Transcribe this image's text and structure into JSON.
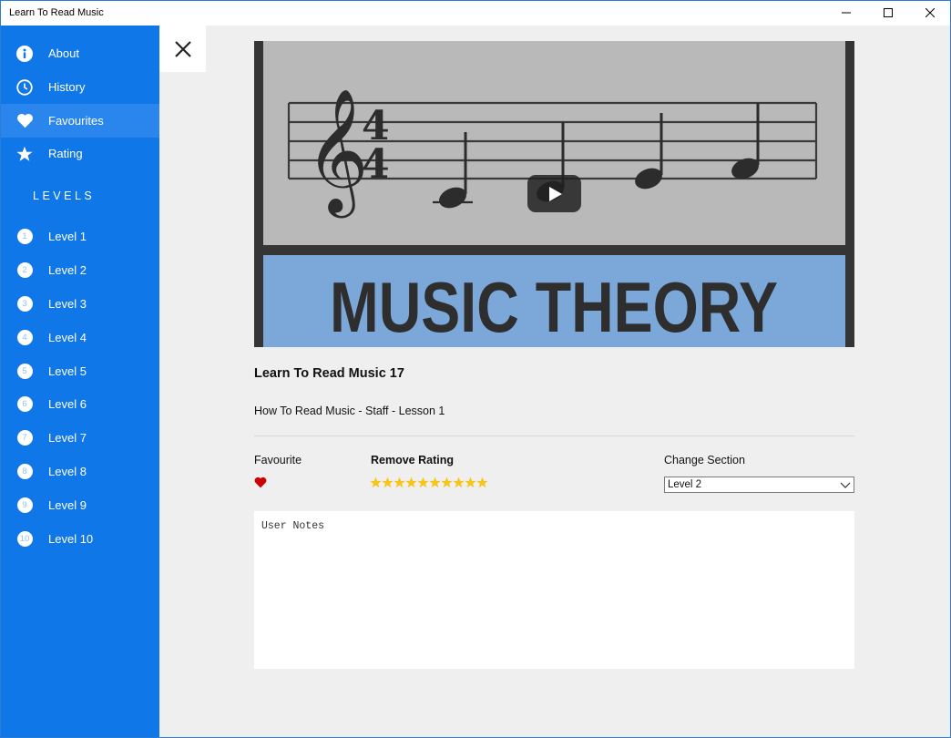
{
  "window": {
    "title": "Learn To Read Music"
  },
  "sidebar": {
    "items": [
      {
        "label": "About",
        "icon": "info-icon"
      },
      {
        "label": "History",
        "icon": "clock-icon"
      },
      {
        "label": "Favourites",
        "icon": "heart-icon",
        "selected": true
      },
      {
        "label": "Rating",
        "icon": "star-icon"
      }
    ],
    "levels_header": "LEVELS",
    "levels": [
      {
        "num": "1",
        "label": "Level 1"
      },
      {
        "num": "2",
        "label": "Level 2"
      },
      {
        "num": "3",
        "label": "Level 3"
      },
      {
        "num": "4",
        "label": "Level 4"
      },
      {
        "num": "5",
        "label": "Level 5"
      },
      {
        "num": "6",
        "label": "Level 6"
      },
      {
        "num": "7",
        "label": "Level 7"
      },
      {
        "num": "8",
        "label": "Level 8"
      },
      {
        "num": "9",
        "label": "Level 9"
      },
      {
        "num": "10",
        "label": "Level 10"
      }
    ]
  },
  "video": {
    "banner_text": "MUSIC THEORY",
    "time_signature_top": "4",
    "time_signature_bottom": "4"
  },
  "detail": {
    "title": "Learn To Read Music 17",
    "subtitle": "How To Read Music - Staff - Lesson 1",
    "favourite_label": "Favourite",
    "rating_label": "Remove Rating",
    "rating_value": 10,
    "rating_max": 10,
    "section_label": "Change Section",
    "section_value": "Level 2",
    "notes_placeholder": "User Notes"
  },
  "colors": {
    "sidebar": "#1077e8",
    "star": "#f5c518",
    "heart": "#cc0000",
    "banner": "#7ba7d9"
  }
}
